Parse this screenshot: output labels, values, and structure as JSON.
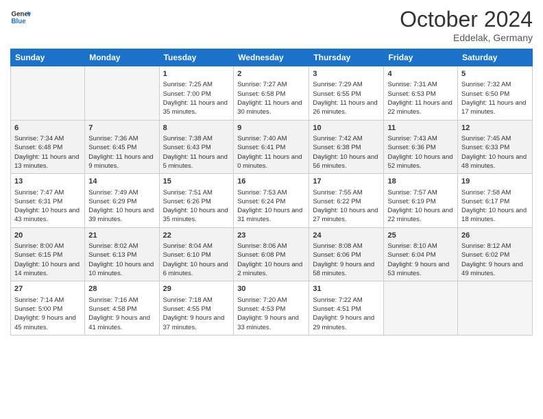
{
  "header": {
    "logo_line1": "General",
    "logo_line2": "Blue",
    "month_title": "October 2024",
    "subtitle": "Eddelak, Germany"
  },
  "days_of_week": [
    "Sunday",
    "Monday",
    "Tuesday",
    "Wednesday",
    "Thursday",
    "Friday",
    "Saturday"
  ],
  "weeks": [
    [
      {
        "day": "",
        "sunrise": "",
        "sunset": "",
        "daylight": ""
      },
      {
        "day": "",
        "sunrise": "",
        "sunset": "",
        "daylight": ""
      },
      {
        "day": "1",
        "sunrise": "Sunrise: 7:25 AM",
        "sunset": "Sunset: 7:00 PM",
        "daylight": "Daylight: 11 hours and 35 minutes."
      },
      {
        "day": "2",
        "sunrise": "Sunrise: 7:27 AM",
        "sunset": "Sunset: 6:58 PM",
        "daylight": "Daylight: 11 hours and 30 minutes."
      },
      {
        "day": "3",
        "sunrise": "Sunrise: 7:29 AM",
        "sunset": "Sunset: 6:55 PM",
        "daylight": "Daylight: 11 hours and 26 minutes."
      },
      {
        "day": "4",
        "sunrise": "Sunrise: 7:31 AM",
        "sunset": "Sunset: 6:53 PM",
        "daylight": "Daylight: 11 hours and 22 minutes."
      },
      {
        "day": "5",
        "sunrise": "Sunrise: 7:32 AM",
        "sunset": "Sunset: 6:50 PM",
        "daylight": "Daylight: 11 hours and 17 minutes."
      }
    ],
    [
      {
        "day": "6",
        "sunrise": "Sunrise: 7:34 AM",
        "sunset": "Sunset: 6:48 PM",
        "daylight": "Daylight: 11 hours and 13 minutes."
      },
      {
        "day": "7",
        "sunrise": "Sunrise: 7:36 AM",
        "sunset": "Sunset: 6:45 PM",
        "daylight": "Daylight: 11 hours and 9 minutes."
      },
      {
        "day": "8",
        "sunrise": "Sunrise: 7:38 AM",
        "sunset": "Sunset: 6:43 PM",
        "daylight": "Daylight: 11 hours and 5 minutes."
      },
      {
        "day": "9",
        "sunrise": "Sunrise: 7:40 AM",
        "sunset": "Sunset: 6:41 PM",
        "daylight": "Daylight: 11 hours and 0 minutes."
      },
      {
        "day": "10",
        "sunrise": "Sunrise: 7:42 AM",
        "sunset": "Sunset: 6:38 PM",
        "daylight": "Daylight: 10 hours and 56 minutes."
      },
      {
        "day": "11",
        "sunrise": "Sunrise: 7:43 AM",
        "sunset": "Sunset: 6:36 PM",
        "daylight": "Daylight: 10 hours and 52 minutes."
      },
      {
        "day": "12",
        "sunrise": "Sunrise: 7:45 AM",
        "sunset": "Sunset: 6:33 PM",
        "daylight": "Daylight: 10 hours and 48 minutes."
      }
    ],
    [
      {
        "day": "13",
        "sunrise": "Sunrise: 7:47 AM",
        "sunset": "Sunset: 6:31 PM",
        "daylight": "Daylight: 10 hours and 43 minutes."
      },
      {
        "day": "14",
        "sunrise": "Sunrise: 7:49 AM",
        "sunset": "Sunset: 6:29 PM",
        "daylight": "Daylight: 10 hours and 39 minutes."
      },
      {
        "day": "15",
        "sunrise": "Sunrise: 7:51 AM",
        "sunset": "Sunset: 6:26 PM",
        "daylight": "Daylight: 10 hours and 35 minutes."
      },
      {
        "day": "16",
        "sunrise": "Sunrise: 7:53 AM",
        "sunset": "Sunset: 6:24 PM",
        "daylight": "Daylight: 10 hours and 31 minutes."
      },
      {
        "day": "17",
        "sunrise": "Sunrise: 7:55 AM",
        "sunset": "Sunset: 6:22 PM",
        "daylight": "Daylight: 10 hours and 27 minutes."
      },
      {
        "day": "18",
        "sunrise": "Sunrise: 7:57 AM",
        "sunset": "Sunset: 6:19 PM",
        "daylight": "Daylight: 10 hours and 22 minutes."
      },
      {
        "day": "19",
        "sunrise": "Sunrise: 7:58 AM",
        "sunset": "Sunset: 6:17 PM",
        "daylight": "Daylight: 10 hours and 18 minutes."
      }
    ],
    [
      {
        "day": "20",
        "sunrise": "Sunrise: 8:00 AM",
        "sunset": "Sunset: 6:15 PM",
        "daylight": "Daylight: 10 hours and 14 minutes."
      },
      {
        "day": "21",
        "sunrise": "Sunrise: 8:02 AM",
        "sunset": "Sunset: 6:13 PM",
        "daylight": "Daylight: 10 hours and 10 minutes."
      },
      {
        "day": "22",
        "sunrise": "Sunrise: 8:04 AM",
        "sunset": "Sunset: 6:10 PM",
        "daylight": "Daylight: 10 hours and 6 minutes."
      },
      {
        "day": "23",
        "sunrise": "Sunrise: 8:06 AM",
        "sunset": "Sunset: 6:08 PM",
        "daylight": "Daylight: 10 hours and 2 minutes."
      },
      {
        "day": "24",
        "sunrise": "Sunrise: 8:08 AM",
        "sunset": "Sunset: 6:06 PM",
        "daylight": "Daylight: 9 hours and 58 minutes."
      },
      {
        "day": "25",
        "sunrise": "Sunrise: 8:10 AM",
        "sunset": "Sunset: 6:04 PM",
        "daylight": "Daylight: 9 hours and 53 minutes."
      },
      {
        "day": "26",
        "sunrise": "Sunrise: 8:12 AM",
        "sunset": "Sunset: 6:02 PM",
        "daylight": "Daylight: 9 hours and 49 minutes."
      }
    ],
    [
      {
        "day": "27",
        "sunrise": "Sunrise: 7:14 AM",
        "sunset": "Sunset: 5:00 PM",
        "daylight": "Daylight: 9 hours and 45 minutes."
      },
      {
        "day": "28",
        "sunrise": "Sunrise: 7:16 AM",
        "sunset": "Sunset: 4:58 PM",
        "daylight": "Daylight: 9 hours and 41 minutes."
      },
      {
        "day": "29",
        "sunrise": "Sunrise: 7:18 AM",
        "sunset": "Sunset: 4:55 PM",
        "daylight": "Daylight: 9 hours and 37 minutes."
      },
      {
        "day": "30",
        "sunrise": "Sunrise: 7:20 AM",
        "sunset": "Sunset: 4:53 PM",
        "daylight": "Daylight: 9 hours and 33 minutes."
      },
      {
        "day": "31",
        "sunrise": "Sunrise: 7:22 AM",
        "sunset": "Sunset: 4:51 PM",
        "daylight": "Daylight: 9 hours and 29 minutes."
      },
      {
        "day": "",
        "sunrise": "",
        "sunset": "",
        "daylight": ""
      },
      {
        "day": "",
        "sunrise": "",
        "sunset": "",
        "daylight": ""
      }
    ]
  ]
}
